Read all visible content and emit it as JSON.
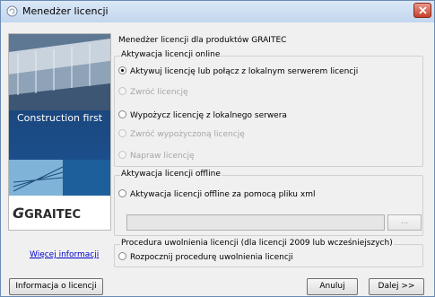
{
  "window": {
    "title": "Menedżer licencji"
  },
  "sidebar": {
    "banner_text": "Construction first",
    "logo_text": "GRAITEC",
    "more_info_link": "Więcej informacji"
  },
  "main": {
    "header": "Menedżer licencji dla produktów GRAITEC",
    "online_group": {
      "legend": "Aktywacja licencji online",
      "options": [
        {
          "label": "Aktywuj licencję lub połącz z lokalnym serwerem licencji",
          "selected": true,
          "enabled": true
        },
        {
          "label": "Zwróć licencję",
          "selected": false,
          "enabled": false
        },
        {
          "label": "Wypożycz licencję z lokalnego serwera",
          "selected": false,
          "enabled": true
        },
        {
          "label": "Zwróć wypożyczoną licencję",
          "selected": false,
          "enabled": false
        },
        {
          "label": "Napraw licencję",
          "selected": false,
          "enabled": false
        }
      ]
    },
    "offline_group": {
      "legend": "Aktywacja licencji offline",
      "option": "Aktywacja licencji offline za pomocą pliku xml",
      "path_value": "",
      "browse_label": "..."
    },
    "release_group": {
      "legend": "Procedura uwolnienia licencji (dla licencji 2009 lub wcześniejszych)",
      "option": "Rozpocznij procedurę uwolnienia licencji"
    }
  },
  "footer": {
    "info_button": "Informacja o licencji",
    "cancel_button": "Anuluj",
    "next_button": "Dalej >>"
  }
}
